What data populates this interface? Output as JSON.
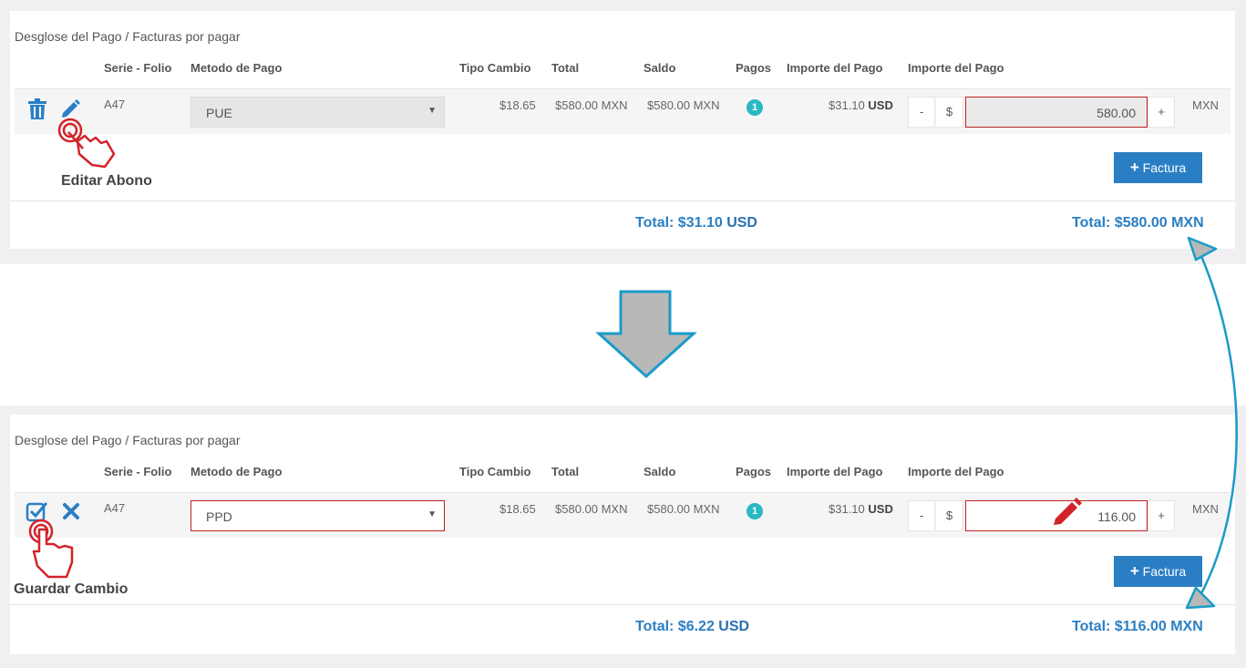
{
  "section_title": "Desglose del Pago / Facturas por pagar",
  "headers": {
    "serie_folio": "Serie - Folio",
    "metodo": "Metodo de Pago",
    "tipo_cambio": "Tipo Cambio",
    "total": "Total",
    "saldo": "Saldo",
    "pagos": "Pagos",
    "importe_pago": "Importe del Pago",
    "importe_pago_2": "Importe del Pago"
  },
  "before": {
    "row": {
      "folio": "A47",
      "metodo": "PUE",
      "tipo_cambio": "$18.65",
      "total": "$580.00 MXN",
      "saldo": "$580.00 MXN",
      "pagos": "1",
      "importe_usd": "$31.10",
      "usd_label": "USD",
      "minus": "-",
      "currency_symbol": "$",
      "amount": "580.00",
      "plus": "+",
      "mxn_label": "MXN"
    },
    "callout": "Editar Abono",
    "add_button": "Factura",
    "total_usd_label": "Total: $31.10",
    "total_usd_unit": "USD",
    "total_mxn": "Total: $580.00 MXN"
  },
  "after": {
    "row": {
      "folio": "A47",
      "metodo": "PPD",
      "tipo_cambio": "$18.65",
      "total": "$580.00 MXN",
      "saldo": "$580.00 MXN",
      "pagos": "1",
      "importe_usd": "$31.10",
      "usd_label": "USD",
      "minus": "-",
      "currency_symbol": "$",
      "amount": "116.00",
      "plus": "+",
      "mxn_label": "MXN"
    },
    "callout": "Guardar Cambio",
    "add_button": "Factura",
    "total_usd_label": "Total: $6.22",
    "total_usd_unit": "USD",
    "total_mxn": "Total: $116.00 MXN"
  },
  "icons": {
    "delete": "trash-icon",
    "edit": "pencil-icon",
    "save": "checkbox-check-icon",
    "cancel": "close-x-icon",
    "hand": "pointing-hand-icon",
    "down_arrow": "down-arrow-icon",
    "link_arrow": "curved-double-arrow-icon"
  },
  "colors": {
    "primary": "#2a7fc4",
    "annotation_red": "#d2232a",
    "badge": "#2bb8c4",
    "link_arrow": "#1a9bc8",
    "big_arrow": "#b8b8b8"
  }
}
